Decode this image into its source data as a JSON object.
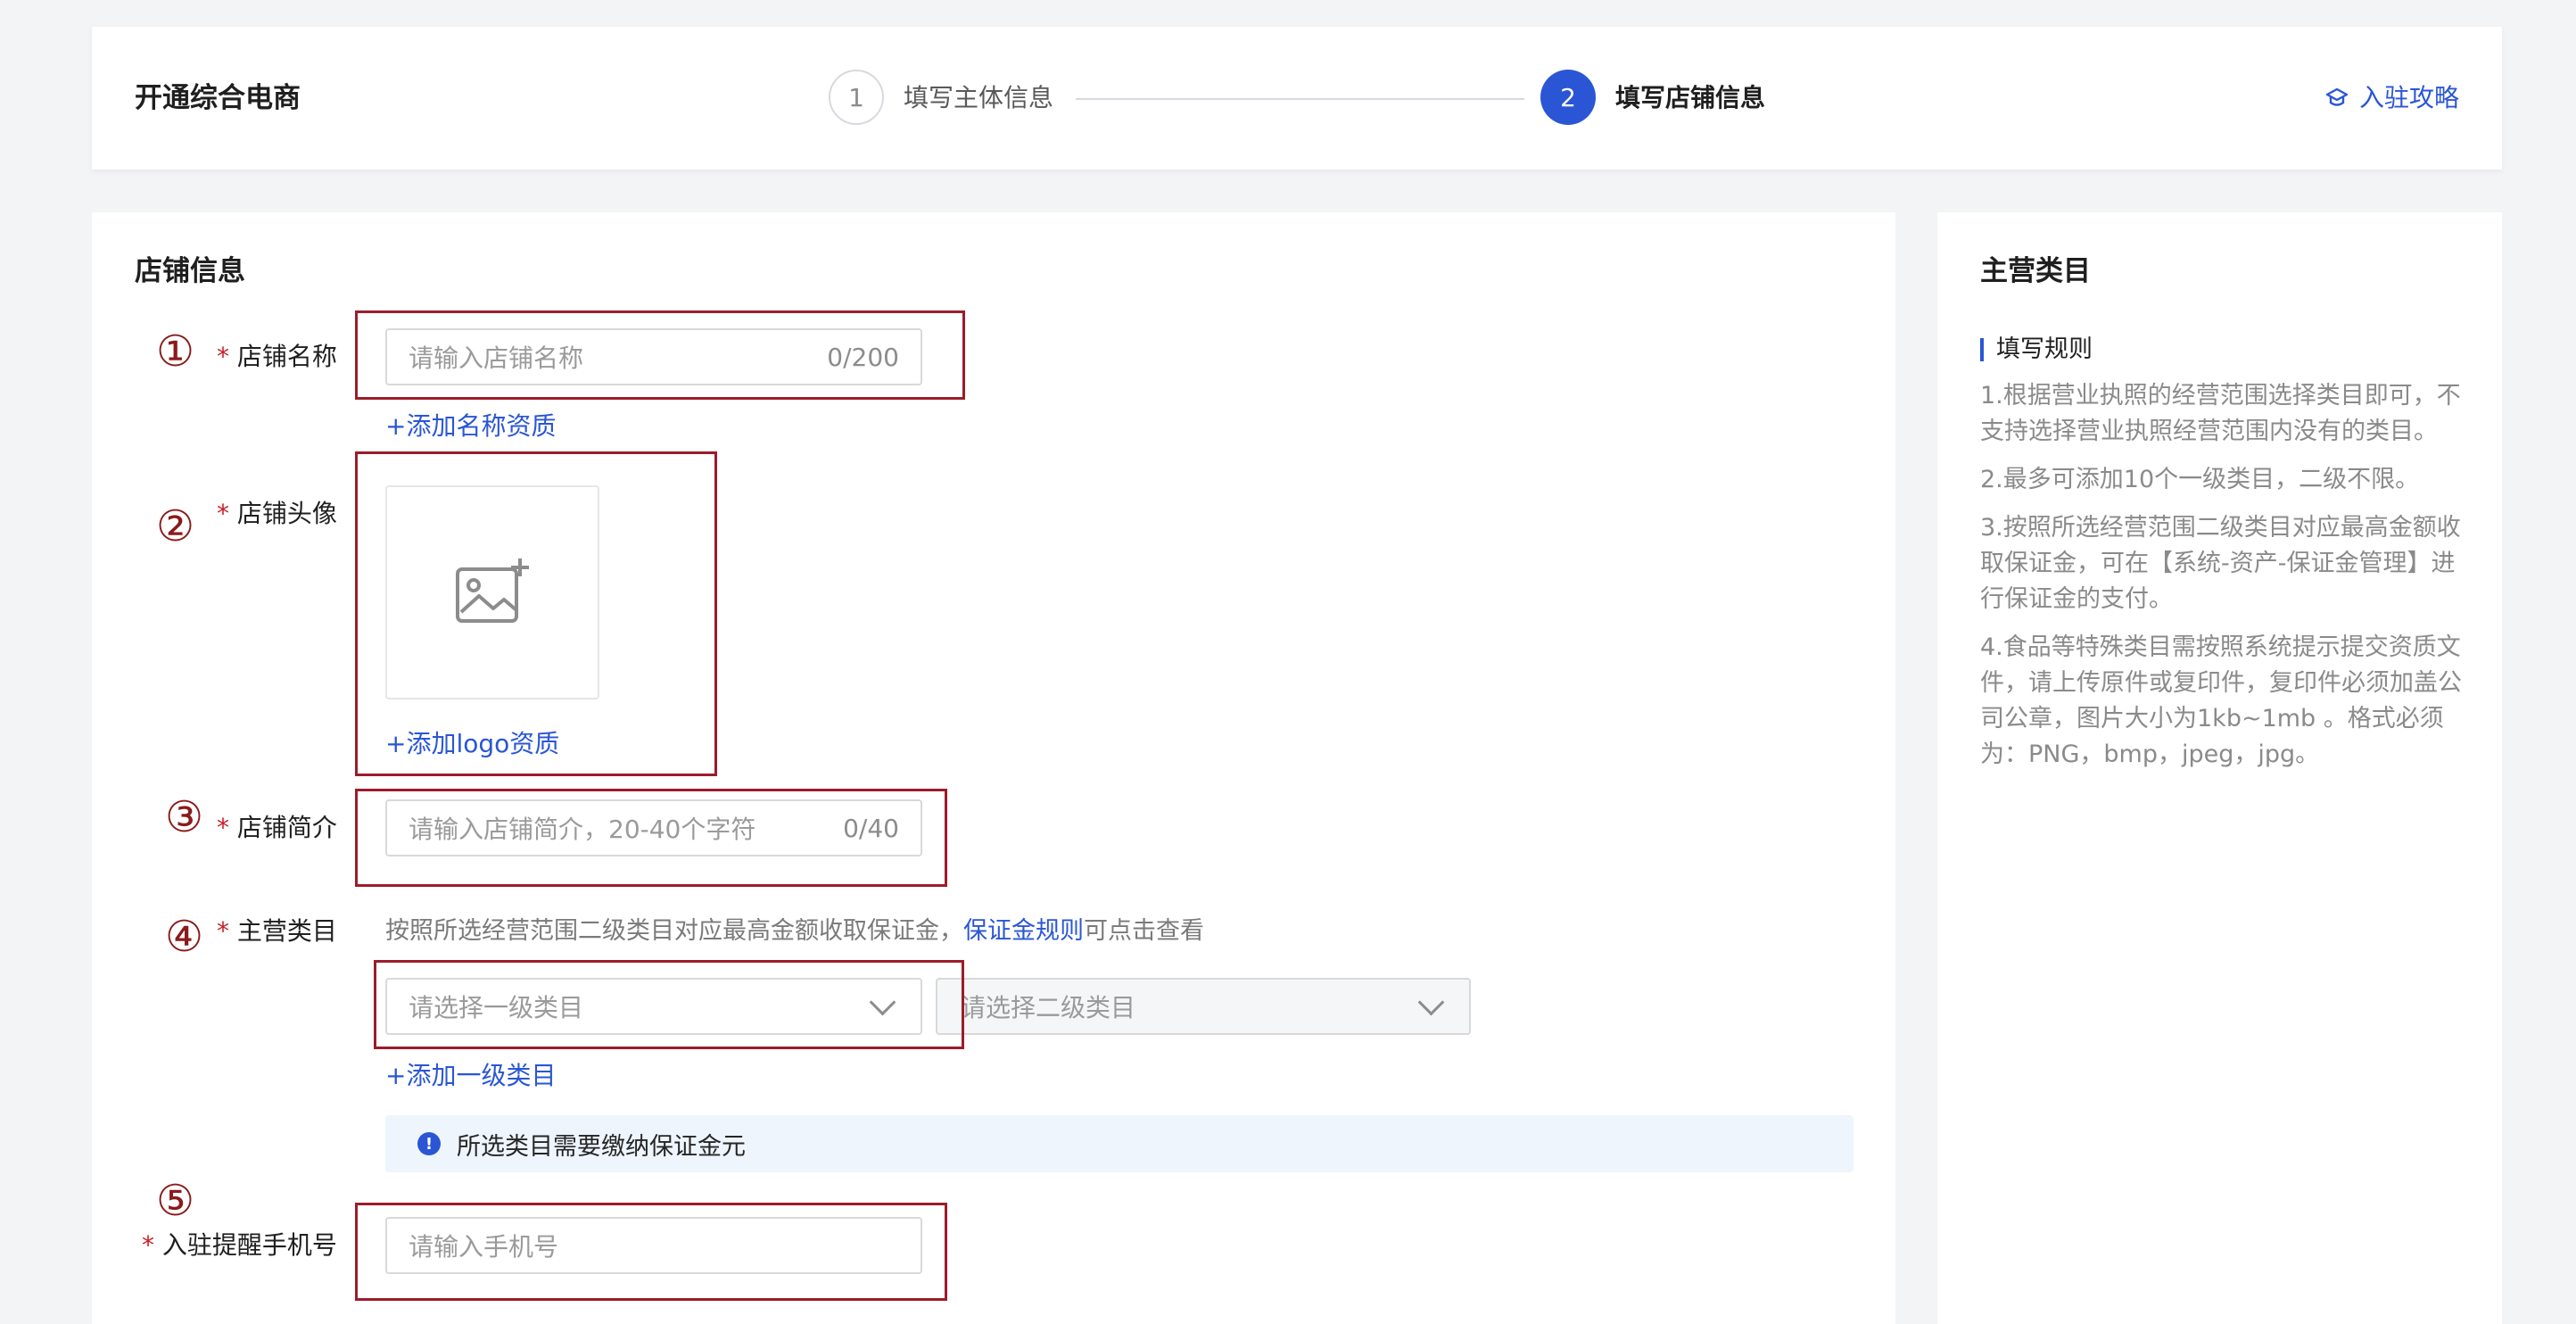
{
  "header": {
    "title": "开通综合电商",
    "steps": [
      {
        "number": "1",
        "label": "填写主体信息"
      },
      {
        "number": "2",
        "label": "填写店铺信息"
      }
    ],
    "guide_link": "入驻攻略"
  },
  "form": {
    "section_title": "店铺信息",
    "markers": [
      "①",
      "②",
      "③",
      "④",
      "⑤"
    ],
    "required_mark": "*",
    "store_name": {
      "label": "店铺名称",
      "placeholder": "请输入店铺名称",
      "count": "0/200",
      "add_link": "+添加名称资质"
    },
    "store_avatar": {
      "label": "店铺头像",
      "add_link": "+添加logo资质"
    },
    "store_intro": {
      "label": "店铺简介",
      "placeholder": "请输入店铺简介，20-40个字符",
      "count": "0/40"
    },
    "main_category": {
      "label": "主营类目",
      "hint_prefix": "按照所选经营范围二级类目对应最高金额收取保证金，",
      "hint_link": "保证金规则",
      "hint_suffix": "可点击查看",
      "level1_placeholder": "请选择一级类目",
      "level2_placeholder": "请选择二级类目",
      "add_link": "+添加一级类目",
      "notice": "所选类目需要缴纳保证金元",
      "notice_icon": "!"
    },
    "phone": {
      "label": "入驻提醒手机号",
      "placeholder": "请输入手机号"
    }
  },
  "side": {
    "title": "主营类目",
    "rules_heading": "填写规则",
    "rules": [
      "1.根据营业执照的经营范围选择类目即可，不支持选择营业执照经营范围内没有的类目。",
      "2.最多可添加10个一级类目，二级不限。",
      "3.按照所选经营范围二级类目对应最高金额收取保证金，可在【系统-资产-保证金管理】进行保证金的支付。",
      "4.食品等特殊类目需按照系统提示提交资质文件，请上传原件或复印件，复印件必须加盖公司公章，图片大小为1kb~1mb 。格式必须为：PNG，bmp，jpeg，jpg。"
    ]
  },
  "colors": {
    "accent": "#2a56d5",
    "required": "#c8202a",
    "annotation": "#9c1c2a"
  }
}
